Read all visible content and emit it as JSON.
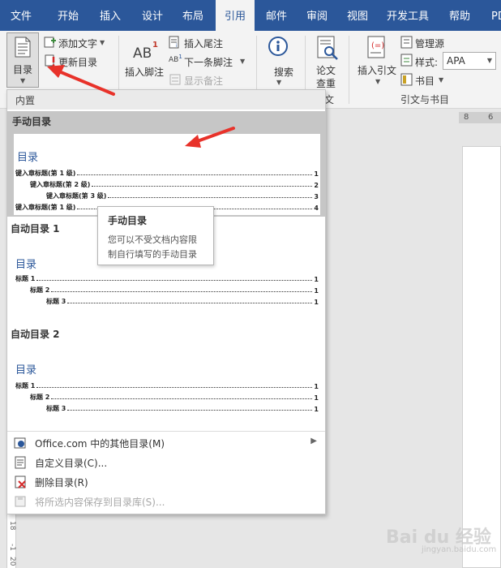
{
  "ribbon_tabs": [
    "文件",
    "开始",
    "插入",
    "设计",
    "布局",
    "引用",
    "邮件",
    "审阅",
    "视图",
    "开发工具",
    "帮助",
    "PDF"
  ],
  "active_tab": "引用",
  "ribbon": {
    "toc_button": "目录",
    "add_text": "添加文字",
    "update_table": "更新目录",
    "insert_footnote": "插入脚注",
    "insert_endnote": "插入尾注",
    "next_footnote": "下一条脚注",
    "show_notes": "显示备注",
    "search": "搜索",
    "paper_check_line1": "论文",
    "paper_check_line2": "查重",
    "insert_citation": "插入引文",
    "manage_sources": "管理源",
    "style_label": "样式:",
    "style_value": "APA",
    "bibliography": "书目",
    "group_citations": "引文与书目",
    "group_partial": "文",
    "ab_superscript": "1"
  },
  "ruler_numbers": [
    "8",
    "6"
  ],
  "gallery": {
    "header": "内置",
    "manual": {
      "title": "手动目录",
      "toc_heading": "目录",
      "lines": [
        {
          "text": "键入章标题(第 1 级)",
          "page": "1"
        },
        {
          "text": "键入章标题(第 2 级)",
          "page": "2"
        },
        {
          "text": "键入章标题(第 3 级)",
          "page": "3"
        },
        {
          "text": "键入章标题(第 1 级)",
          "page": "4"
        }
      ]
    },
    "auto1": {
      "title": "自动目录 1",
      "toc_heading": "目录",
      "lines": [
        {
          "text": "标题 1",
          "page": "1"
        },
        {
          "text": "标题 2",
          "page": "1"
        },
        {
          "text": "标题 3",
          "page": "1"
        }
      ]
    },
    "auto2": {
      "title": "自动目录 2",
      "toc_heading": "目录",
      "lines": [
        {
          "text": "标题 1",
          "page": "1"
        },
        {
          "text": "标题 2",
          "page": "1"
        },
        {
          "text": "标题 3",
          "page": "1"
        }
      ]
    },
    "menu": [
      {
        "label": "Office.com 中的其他目录(M)",
        "icon": "office-icon",
        "enabled": true,
        "submenu": true
      },
      {
        "label": "自定义目录(C)...",
        "icon": "custom-toc-icon",
        "enabled": true,
        "submenu": false
      },
      {
        "label": "删除目录(R)",
        "icon": "delete-toc-icon",
        "enabled": true,
        "submenu": false
      },
      {
        "label": "将所选内容保存到目录库(S)...",
        "icon": "save-gallery-icon",
        "enabled": false,
        "submenu": false
      }
    ]
  },
  "tooltip": {
    "title": "手动目录",
    "line1": "您可以不受文档内容限",
    "line2": "制自行填写的手动目录"
  },
  "watermark": {
    "brand": "Bai du 经验",
    "url": "jingyan.baidu.com"
  },
  "colors": {
    "ribbon_blue": "#2b579a",
    "heading_blue": "#2b579a",
    "arrow_red": "#e8322a",
    "selection_gray": "#c6c6c6"
  }
}
